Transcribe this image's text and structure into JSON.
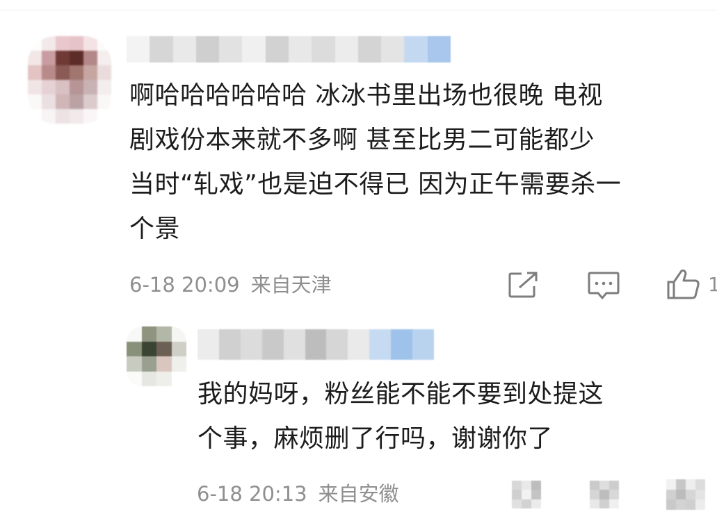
{
  "comments": [
    {
      "text_lines": [
        "啊哈哈哈哈哈哈 冰冰书里出场也很晚 电视",
        "剧戏份本来就不多啊 甚至比男二可能都少",
        "当时“轧戏”也是迫不得已 因为正午需要杀一",
        "个景"
      ],
      "time": "6-18 20:09",
      "location": "来自天津",
      "actions": {
        "share_icon": "share-icon",
        "reply_icon": "comment-icon",
        "like_icon": "thumbs-up-icon",
        "like_count": "1"
      }
    },
    {
      "text_lines": [
        "我的妈呀，粉丝能不能不要到处提这",
        "个事，麻烦删了行吗，谢谢你了"
      ],
      "time": "6-18 20:13",
      "location": "来自安徽",
      "actions": {
        "share_icon": "share-icon",
        "reply_icon": "comment-icon",
        "like_icon": "thumbs-up-icon"
      }
    }
  ],
  "colors": {
    "text": "#1c1c1c",
    "meta": "#8f8f8f",
    "icon": "#7d7d7d",
    "background": "#ffffff",
    "blurred_name_accent": "#a9c7ec"
  }
}
